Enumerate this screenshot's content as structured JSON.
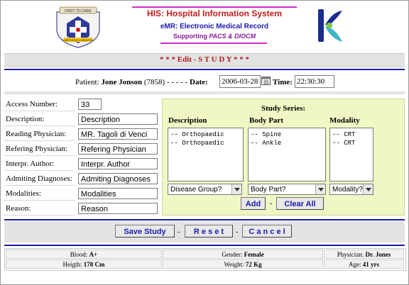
{
  "header": {
    "title": "HIS: Hospital Information System",
    "subtitle": "eMR: Electronic Medical Record",
    "supporting_prefix": "Supporting ",
    "supporting_tail": "PACS & DIOCM",
    "logo1_icon": "first-to-care-emergency-medicine-logo",
    "logo2_icon": "k-brand-logo"
  },
  "page": {
    "edit_title": "* * * Edit - S T U D Y * * *"
  },
  "patient": {
    "label": "Patient:",
    "name": "Jone Jonson",
    "id": "(7858)",
    "dashes": "- - - - -",
    "date_label": "Date:",
    "date_value": "2006-03-28",
    "time_label": "Time:",
    "time_value": "22:30:30"
  },
  "form": {
    "access_number": {
      "label": "Access Number:",
      "value": "33"
    },
    "description": {
      "label": "Description:",
      "value": "Description"
    },
    "reading_physician": {
      "label": "Reading Physician:",
      "value": "MR. Tagoli di Venci"
    },
    "refering_physician": {
      "label": "Refering Physician:",
      "value": "Refering Physician"
    },
    "interpr_author": {
      "label": "Interpr. Author:",
      "value": "Interpr. Author"
    },
    "admiting_diagnoses": {
      "label": "Admiting Diagnoses:",
      "value": "Admiting Diagnoses"
    },
    "modalities": {
      "label": "Modalities:",
      "value": "Modalities"
    },
    "reason": {
      "label": "Reason:",
      "value": "Reason"
    }
  },
  "series": {
    "title": "Study Series:",
    "columns": {
      "description": "Description",
      "body_part": "Body Part",
      "modality": "Modality"
    },
    "description_items": [
      "-- Orthopaedic",
      "-- Orthopaedic"
    ],
    "body_part_items": [
      "-- Spine",
      "-- Ankle"
    ],
    "modality_items": [
      "-- CRT",
      "-- CRT"
    ],
    "disease_group_select": "Disease Group?",
    "body_part_select": "Body Part?",
    "modality_select": "Modality?",
    "add_label": "Add",
    "clear_all_label": "Clear All",
    "separator": "-"
  },
  "actions": {
    "save_label": "Save Study",
    "reset_label": "R e s e t",
    "cancel_label": "C a n c e l",
    "separator": "-"
  },
  "footer": {
    "blood_label": "Blood:",
    "blood_value": "A+",
    "gender_label": "Gender:",
    "gender_value": "Female",
    "physician_label": "Physician:",
    "physician_value": "Dr. Jones",
    "height_label": "Heigth:",
    "height_value": "170 Cm",
    "weight_label": "Weight:",
    "weight_value": "72 Kg",
    "age_label": "Age:",
    "age_value": "41 yrs"
  },
  "colors": {
    "title_red": "#c21a1a",
    "accent_blue": "#1a1ab0",
    "magenta_line": "#cc2ac6",
    "series_panel_bg": "#eef8c4"
  }
}
